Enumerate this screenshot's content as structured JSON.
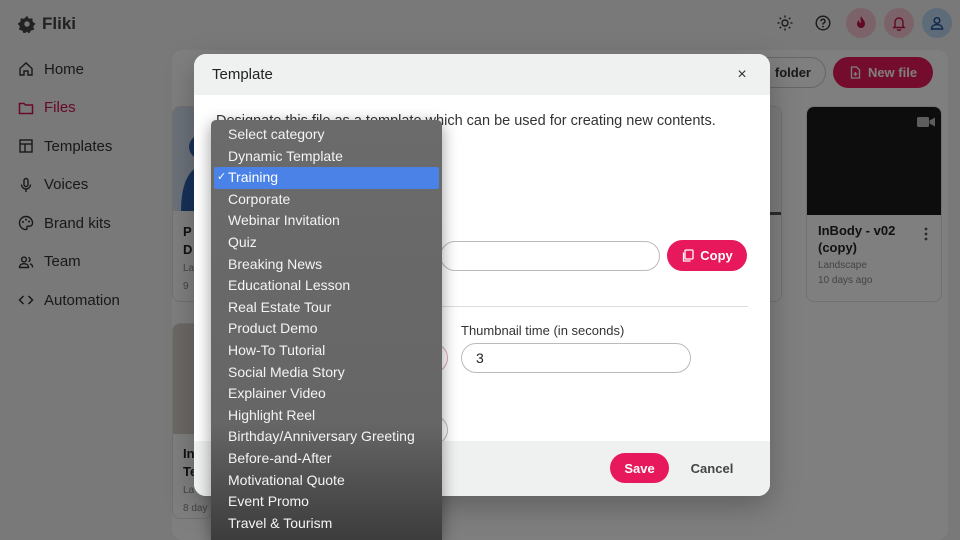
{
  "app": {
    "name": "Fliki"
  },
  "sidebar": {
    "items": [
      {
        "label": "Home",
        "icon": "home-icon"
      },
      {
        "label": "Files",
        "icon": "folder-icon",
        "active": true
      },
      {
        "label": "Templates",
        "icon": "templates-icon"
      },
      {
        "label": "Voices",
        "icon": "microphone-icon"
      },
      {
        "label": "Brand kits",
        "icon": "palette-icon"
      },
      {
        "label": "Team",
        "icon": "team-icon"
      },
      {
        "label": "Automation",
        "icon": "code-icon"
      }
    ]
  },
  "toolbar": {
    "folder_label": "folder",
    "new_file_label": "New file"
  },
  "cards": {
    "right_title": "InBody - v02 (copy)",
    "right_format": "Landscape",
    "right_age": "10 days ago",
    "left_peek_1": "P",
    "left_peek_2": "D",
    "left_peek_3": "La",
    "left_peek_4": "9",
    "left_peek_5": "In",
    "left_peek_6": "Te",
    "left_peek_7": "La",
    "left_peek_8": "8 day"
  },
  "modal": {
    "title": "Template",
    "close_label": "×",
    "description": "Designate this file as a template which can be used for creating new contents.",
    "copy_label": "Copy",
    "thumbnail_label": "Thumbnail time (in seconds)",
    "thumbnail_value": "3",
    "save_label": "Save",
    "cancel_label": "Cancel"
  },
  "dropdown": {
    "check_mark": "✓",
    "options": [
      "Select category",
      "Dynamic Template",
      "Training",
      "Corporate",
      "Webinar Invitation",
      "Quiz",
      "Breaking News",
      "Educational Lesson",
      "Real Estate Tour",
      "Product Demo",
      "How-To Tutorial",
      "Social Media Story",
      "Explainer Video",
      "Highlight Reel",
      "Birthday/Anniversary Greeting",
      "Before-and-After",
      "Motivational Quote",
      "Event Promo",
      "Travel & Tourism"
    ],
    "selected": "Training"
  },
  "colors": {
    "brand": "#e8185c",
    "selection": "#4b82e8"
  }
}
